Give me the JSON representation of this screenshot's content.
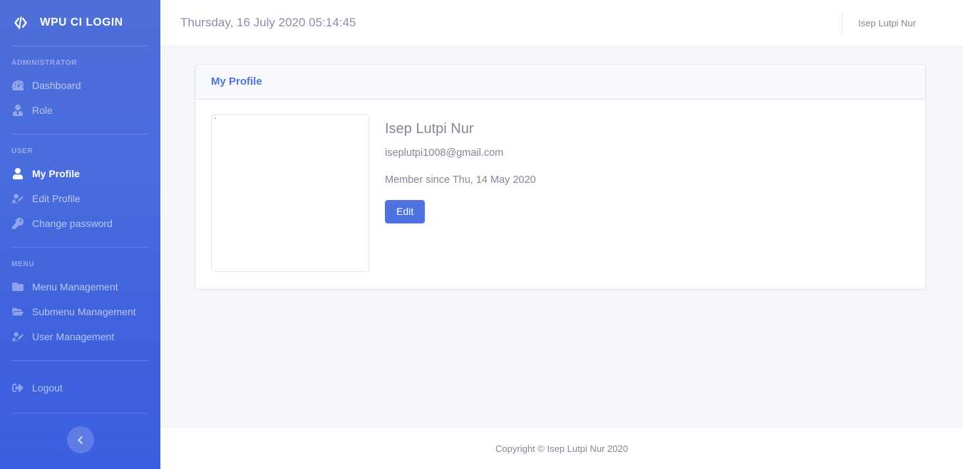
{
  "sidebar": {
    "brand": {
      "label": "WPU CI LOGIN",
      "icon": "code-icon"
    },
    "sections": [
      {
        "heading": "ADMINISTRATOR",
        "items": [
          {
            "label": "Dashboard",
            "icon": "tachometer-icon",
            "active": false
          },
          {
            "label": "Role",
            "icon": "user-tie-icon",
            "active": false
          }
        ]
      },
      {
        "heading": "USER",
        "items": [
          {
            "label": "My Profile",
            "icon": "user-icon",
            "active": true
          },
          {
            "label": "Edit Profile",
            "icon": "user-edit-icon",
            "active": false
          },
          {
            "label": "Change password",
            "icon": "key-icon",
            "active": false
          }
        ]
      },
      {
        "heading": "MENU",
        "items": [
          {
            "label": "Menu Management",
            "icon": "folder-icon",
            "active": false
          },
          {
            "label": "Submenu Management",
            "icon": "folder-open-icon",
            "active": false
          },
          {
            "label": "User Management",
            "icon": "user-edit-icon",
            "active": false
          }
        ]
      }
    ],
    "logout": {
      "label": "Logout",
      "icon": "sign-out-icon"
    },
    "toggle": {
      "icon": "chevron-left-icon"
    },
    "colors": {
      "top": "#4e6ed8",
      "bottom": "#3a5fe0"
    }
  },
  "topbar": {
    "datetime": "Thursday, 16 July 2020 05:14:45",
    "username": "Isep Lutpi Nur",
    "avatar_icon": "user-avatar-photo"
  },
  "card": {
    "title": "My Profile",
    "profile": {
      "photo_alt": "profile-photo",
      "name": "Isep Lutpi Nur",
      "email": "iseplutpi1008@gmail.com",
      "member_since": "Member since Thu, 14 May 2020",
      "edit_label": "Edit"
    }
  },
  "footer": {
    "copyright": "Copyright © Isep Lutpi Nur 2020"
  },
  "colors": {
    "primary": "#4e73df",
    "page_bg": "#f6f7fb",
    "card_header_bg": "#f8f9fc",
    "border": "#e3e6f0",
    "muted_text": "#858796"
  }
}
